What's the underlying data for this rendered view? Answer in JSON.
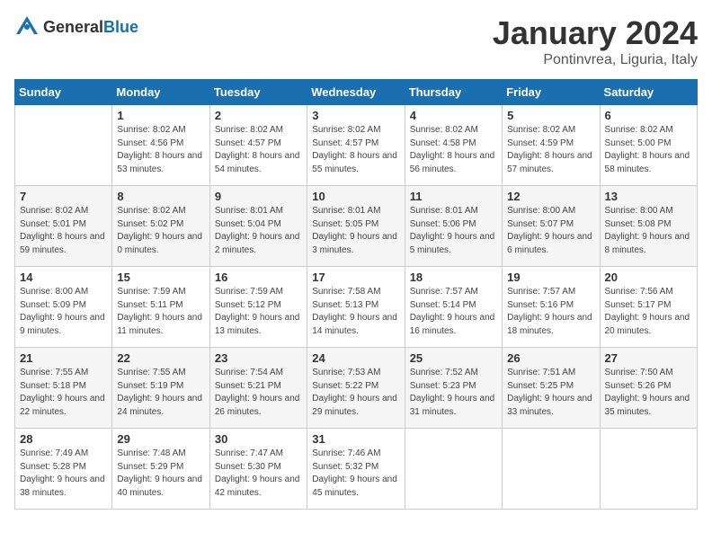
{
  "header": {
    "logo_general": "General",
    "logo_blue": "Blue",
    "month": "January 2024",
    "location": "Pontinvrea, Liguria, Italy"
  },
  "days_of_week": [
    "Sunday",
    "Monday",
    "Tuesday",
    "Wednesday",
    "Thursday",
    "Friday",
    "Saturday"
  ],
  "weeks": [
    [
      {
        "day": "",
        "sunrise": "",
        "sunset": "",
        "daylight": ""
      },
      {
        "day": "1",
        "sunrise": "Sunrise: 8:02 AM",
        "sunset": "Sunset: 4:56 PM",
        "daylight": "Daylight: 8 hours and 53 minutes."
      },
      {
        "day": "2",
        "sunrise": "Sunrise: 8:02 AM",
        "sunset": "Sunset: 4:57 PM",
        "daylight": "Daylight: 8 hours and 54 minutes."
      },
      {
        "day": "3",
        "sunrise": "Sunrise: 8:02 AM",
        "sunset": "Sunset: 4:57 PM",
        "daylight": "Daylight: 8 hours and 55 minutes."
      },
      {
        "day": "4",
        "sunrise": "Sunrise: 8:02 AM",
        "sunset": "Sunset: 4:58 PM",
        "daylight": "Daylight: 8 hours and 56 minutes."
      },
      {
        "day": "5",
        "sunrise": "Sunrise: 8:02 AM",
        "sunset": "Sunset: 4:59 PM",
        "daylight": "Daylight: 8 hours and 57 minutes."
      },
      {
        "day": "6",
        "sunrise": "Sunrise: 8:02 AM",
        "sunset": "Sunset: 5:00 PM",
        "daylight": "Daylight: 8 hours and 58 minutes."
      }
    ],
    [
      {
        "day": "7",
        "sunrise": "Sunrise: 8:02 AM",
        "sunset": "Sunset: 5:01 PM",
        "daylight": "Daylight: 8 hours and 59 minutes."
      },
      {
        "day": "8",
        "sunrise": "Sunrise: 8:02 AM",
        "sunset": "Sunset: 5:02 PM",
        "daylight": "Daylight: 9 hours and 0 minutes."
      },
      {
        "day": "9",
        "sunrise": "Sunrise: 8:01 AM",
        "sunset": "Sunset: 5:04 PM",
        "daylight": "Daylight: 9 hours and 2 minutes."
      },
      {
        "day": "10",
        "sunrise": "Sunrise: 8:01 AM",
        "sunset": "Sunset: 5:05 PM",
        "daylight": "Daylight: 9 hours and 3 minutes."
      },
      {
        "day": "11",
        "sunrise": "Sunrise: 8:01 AM",
        "sunset": "Sunset: 5:06 PM",
        "daylight": "Daylight: 9 hours and 5 minutes."
      },
      {
        "day": "12",
        "sunrise": "Sunrise: 8:00 AM",
        "sunset": "Sunset: 5:07 PM",
        "daylight": "Daylight: 9 hours and 6 minutes."
      },
      {
        "day": "13",
        "sunrise": "Sunrise: 8:00 AM",
        "sunset": "Sunset: 5:08 PM",
        "daylight": "Daylight: 9 hours and 8 minutes."
      }
    ],
    [
      {
        "day": "14",
        "sunrise": "Sunrise: 8:00 AM",
        "sunset": "Sunset: 5:09 PM",
        "daylight": "Daylight: 9 hours and 9 minutes."
      },
      {
        "day": "15",
        "sunrise": "Sunrise: 7:59 AM",
        "sunset": "Sunset: 5:11 PM",
        "daylight": "Daylight: 9 hours and 11 minutes."
      },
      {
        "day": "16",
        "sunrise": "Sunrise: 7:59 AM",
        "sunset": "Sunset: 5:12 PM",
        "daylight": "Daylight: 9 hours and 13 minutes."
      },
      {
        "day": "17",
        "sunrise": "Sunrise: 7:58 AM",
        "sunset": "Sunset: 5:13 PM",
        "daylight": "Daylight: 9 hours and 14 minutes."
      },
      {
        "day": "18",
        "sunrise": "Sunrise: 7:57 AM",
        "sunset": "Sunset: 5:14 PM",
        "daylight": "Daylight: 9 hours and 16 minutes."
      },
      {
        "day": "19",
        "sunrise": "Sunrise: 7:57 AM",
        "sunset": "Sunset: 5:16 PM",
        "daylight": "Daylight: 9 hours and 18 minutes."
      },
      {
        "day": "20",
        "sunrise": "Sunrise: 7:56 AM",
        "sunset": "Sunset: 5:17 PM",
        "daylight": "Daylight: 9 hours and 20 minutes."
      }
    ],
    [
      {
        "day": "21",
        "sunrise": "Sunrise: 7:55 AM",
        "sunset": "Sunset: 5:18 PM",
        "daylight": "Daylight: 9 hours and 22 minutes."
      },
      {
        "day": "22",
        "sunrise": "Sunrise: 7:55 AM",
        "sunset": "Sunset: 5:19 PM",
        "daylight": "Daylight: 9 hours and 24 minutes."
      },
      {
        "day": "23",
        "sunrise": "Sunrise: 7:54 AM",
        "sunset": "Sunset: 5:21 PM",
        "daylight": "Daylight: 9 hours and 26 minutes."
      },
      {
        "day": "24",
        "sunrise": "Sunrise: 7:53 AM",
        "sunset": "Sunset: 5:22 PM",
        "daylight": "Daylight: 9 hours and 29 minutes."
      },
      {
        "day": "25",
        "sunrise": "Sunrise: 7:52 AM",
        "sunset": "Sunset: 5:23 PM",
        "daylight": "Daylight: 9 hours and 31 minutes."
      },
      {
        "day": "26",
        "sunrise": "Sunrise: 7:51 AM",
        "sunset": "Sunset: 5:25 PM",
        "daylight": "Daylight: 9 hours and 33 minutes."
      },
      {
        "day": "27",
        "sunrise": "Sunrise: 7:50 AM",
        "sunset": "Sunset: 5:26 PM",
        "daylight": "Daylight: 9 hours and 35 minutes."
      }
    ],
    [
      {
        "day": "28",
        "sunrise": "Sunrise: 7:49 AM",
        "sunset": "Sunset: 5:28 PM",
        "daylight": "Daylight: 9 hours and 38 minutes."
      },
      {
        "day": "29",
        "sunrise": "Sunrise: 7:48 AM",
        "sunset": "Sunset: 5:29 PM",
        "daylight": "Daylight: 9 hours and 40 minutes."
      },
      {
        "day": "30",
        "sunrise": "Sunrise: 7:47 AM",
        "sunset": "Sunset: 5:30 PM",
        "daylight": "Daylight: 9 hours and 42 minutes."
      },
      {
        "day": "31",
        "sunrise": "Sunrise: 7:46 AM",
        "sunset": "Sunset: 5:32 PM",
        "daylight": "Daylight: 9 hours and 45 minutes."
      },
      {
        "day": "",
        "sunrise": "",
        "sunset": "",
        "daylight": ""
      },
      {
        "day": "",
        "sunrise": "",
        "sunset": "",
        "daylight": ""
      },
      {
        "day": "",
        "sunrise": "",
        "sunset": "",
        "daylight": ""
      }
    ]
  ]
}
